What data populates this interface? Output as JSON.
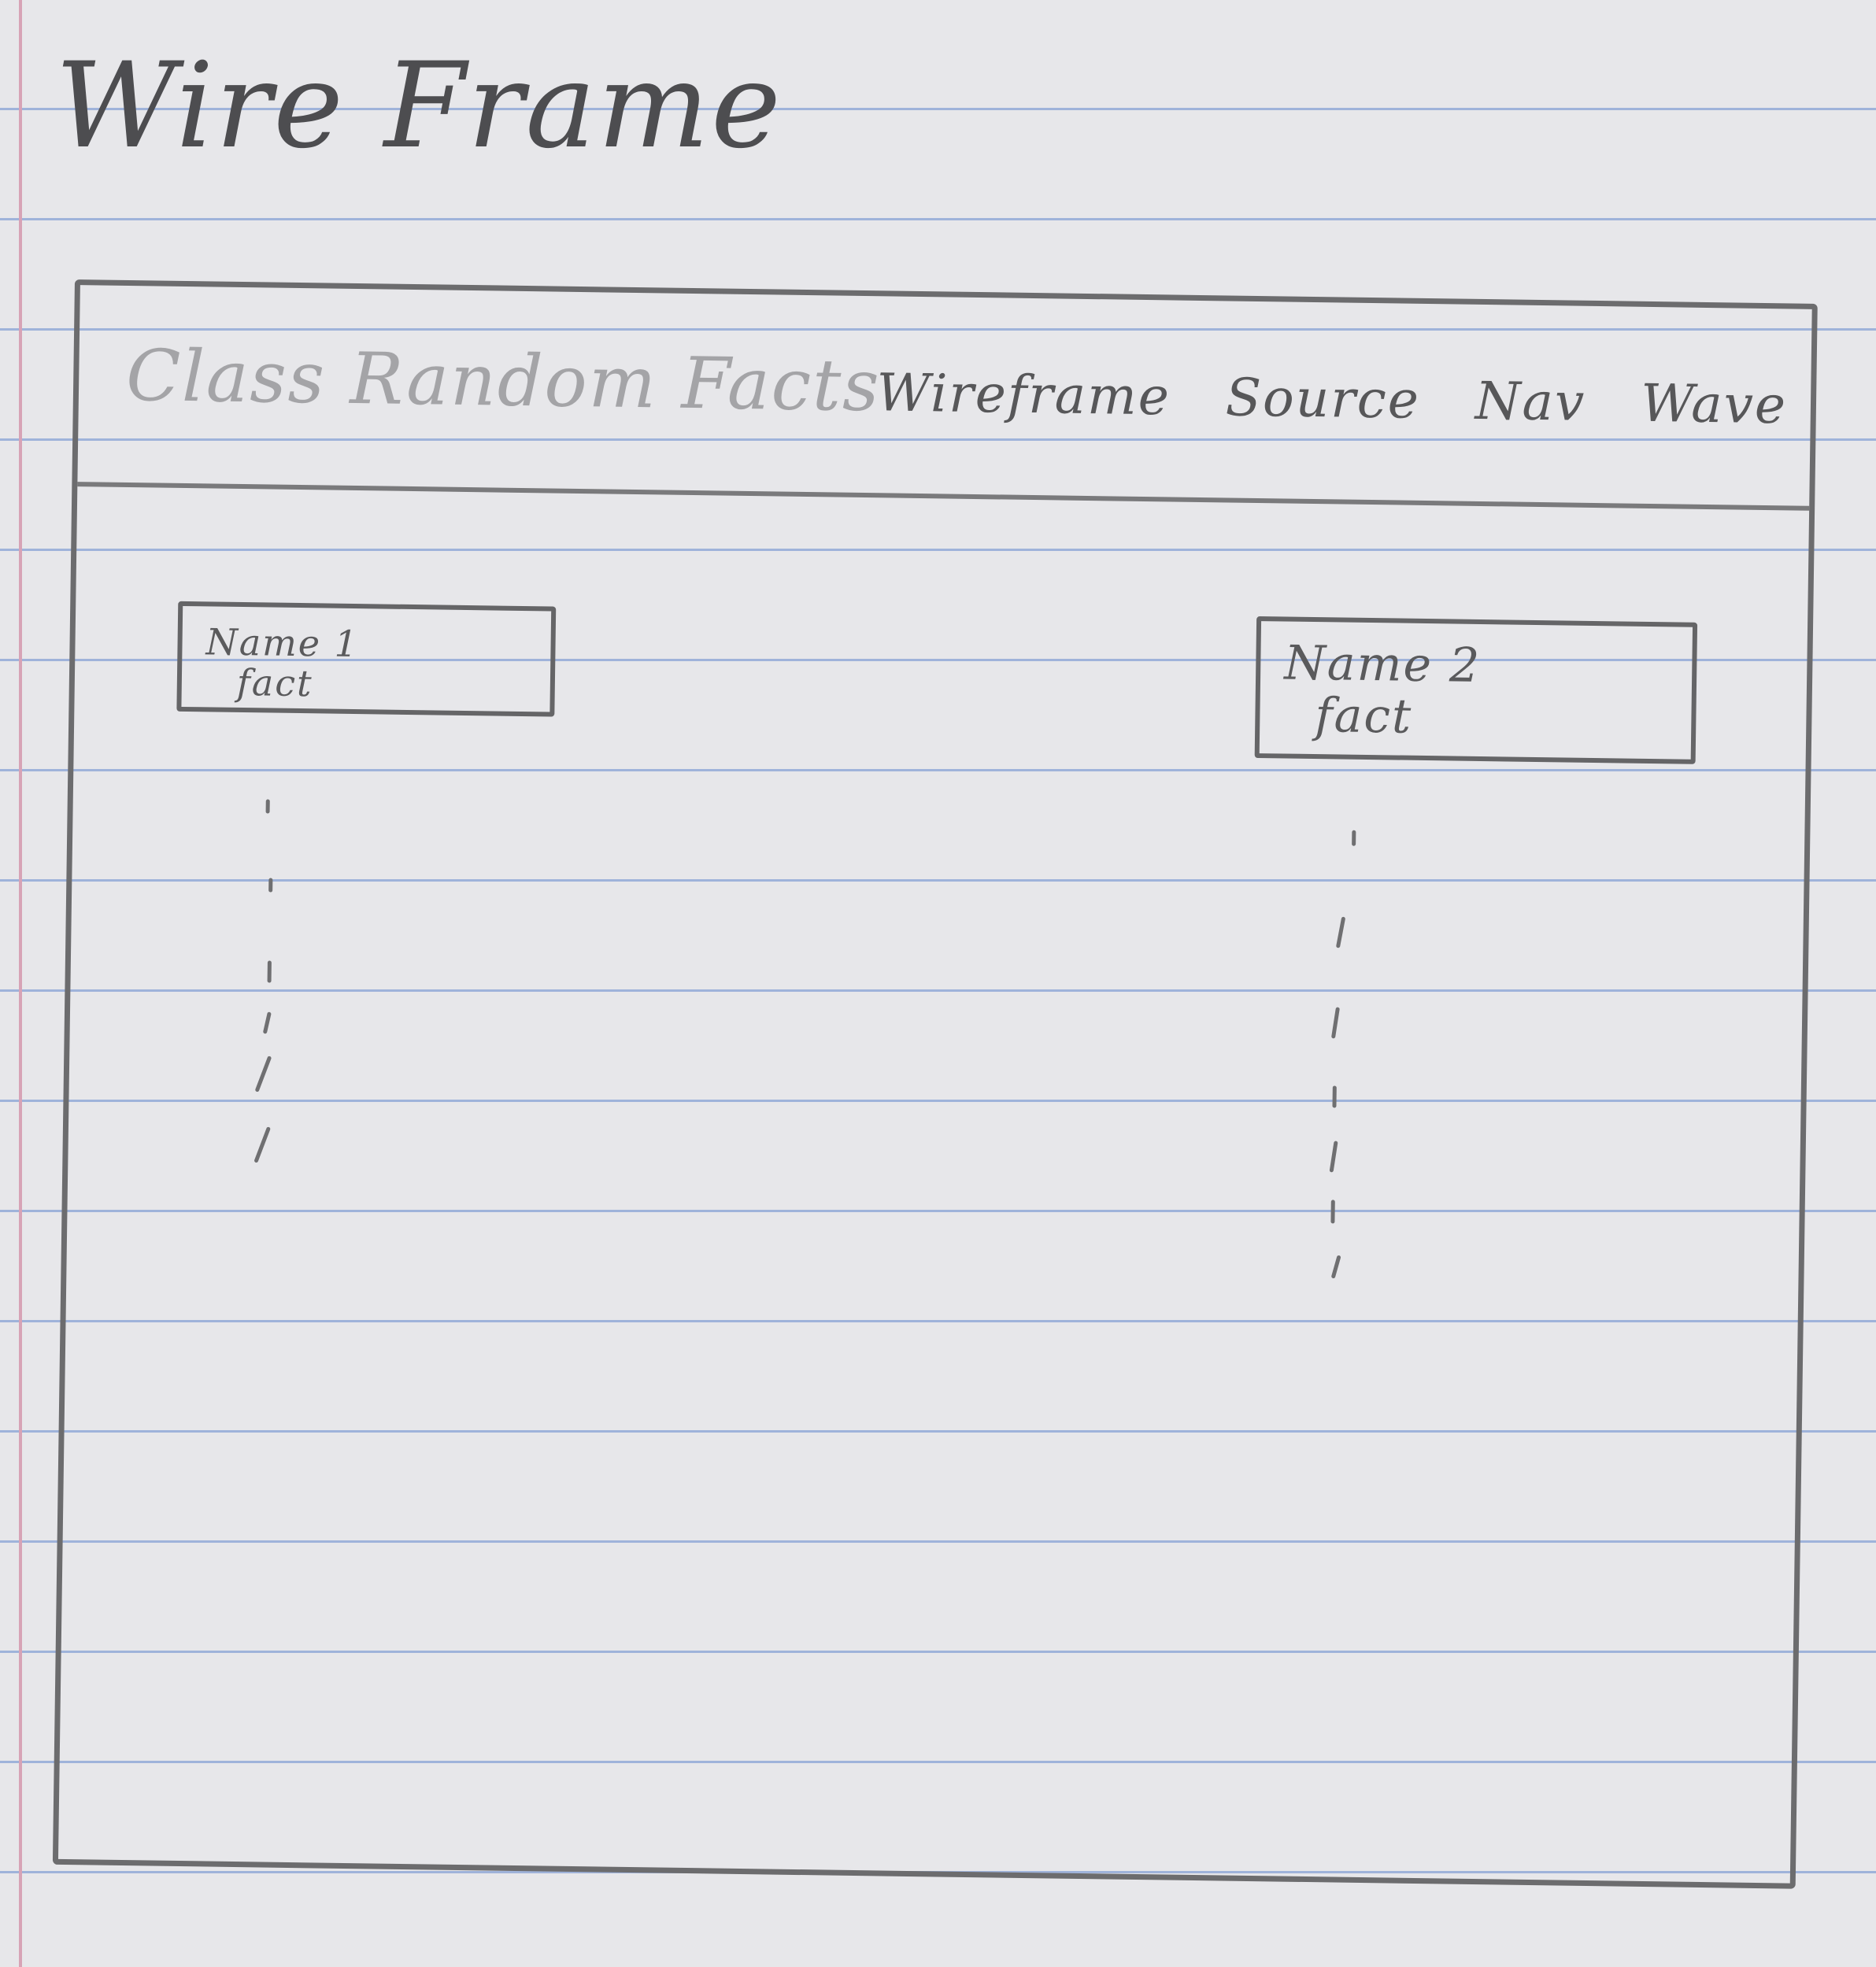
{
  "page": {
    "heading": "Wire Frame"
  },
  "header": {
    "title": "Class Random Facts",
    "nav": [
      {
        "label": "Wireframe"
      },
      {
        "label": "Source"
      },
      {
        "label": "Nav"
      },
      {
        "label": "Wave"
      }
    ]
  },
  "cards": [
    {
      "name": "Name 1",
      "fact": "fact"
    },
    {
      "name": "Name 2",
      "fact": "fact"
    }
  ]
}
